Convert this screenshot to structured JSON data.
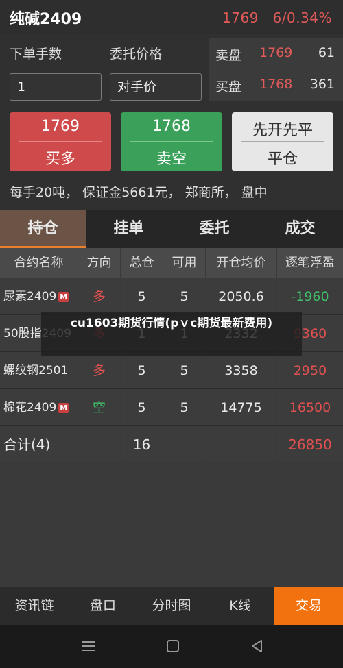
{
  "header": {
    "title": "纯碱2409",
    "price_change": "1769   6/0.34%"
  },
  "order_form": {
    "qty_label": "下单手数",
    "price_label": "委托价格",
    "qty_value": "1",
    "price_value": "对手价"
  },
  "order_book": [
    {
      "side": "卖盘",
      "price": "1769",
      "qty": "61"
    },
    {
      "side": "买盘",
      "price": "1768",
      "qty": "361"
    }
  ],
  "buttons": {
    "buy": {
      "price": "1769",
      "label": "买多"
    },
    "sell": {
      "price": "1768",
      "label": "卖空"
    },
    "close": {
      "top": "先开先平",
      "label": "平仓"
    }
  },
  "info_line": "每手20吨， 保证金5661元， 郑商所， 盘中",
  "tabs": [
    "持仓",
    "挂单",
    "委托",
    "成交"
  ],
  "table": {
    "headers": [
      "合约名称",
      "方向",
      "总仓",
      "可用",
      "开仓均价",
      "逐笔浮盈"
    ],
    "rows": [
      {
        "name": "尿素2409",
        "badge": "M",
        "dir": "多",
        "total": "5",
        "avail": "5",
        "avg": "2050.6",
        "pnl": "-1960"
      },
      {
        "name": "50股指2409",
        "badge": "",
        "dir": "多",
        "total": "1",
        "avail": "1",
        "avg": "2332",
        "pnl": "9360"
      },
      {
        "name": "螺纹钢2501",
        "badge": "",
        "dir": "多",
        "total": "5",
        "avail": "5",
        "avg": "3358",
        "pnl": "2950"
      },
      {
        "name": "棉花2409",
        "badge": "M",
        "dir": "空",
        "total": "5",
        "avail": "5",
        "avg": "14775",
        "pnl": "16500"
      }
    ],
    "summary": {
      "label": "合计(4)",
      "total": "16",
      "pnl": "26850"
    }
  },
  "overlay_text": "cu1603期货行情(pｖc期货最新费用)",
  "bottom_nav": [
    "资讯链",
    "盘口",
    "分时图",
    "K线",
    "交易"
  ],
  "system_nav_icons": [
    "menu-icon",
    "home-icon",
    "back-icon"
  ],
  "colors": {
    "up": "#e05050",
    "down": "#3fbf6a",
    "accent": "#f2720f",
    "active_tab": "#6b5345"
  }
}
